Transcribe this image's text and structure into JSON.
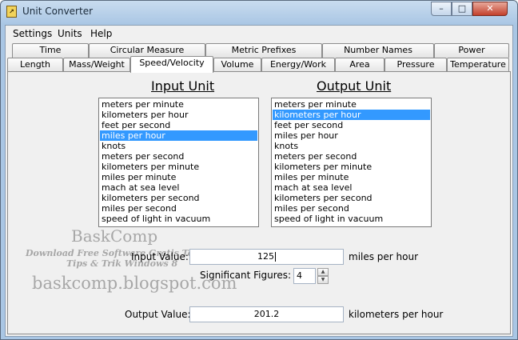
{
  "window": {
    "title": "Unit Converter",
    "icon": "converter-app-icon"
  },
  "titlebar_buttons": {
    "minimize": "–",
    "maximize": "□",
    "close": "✕"
  },
  "menu": [
    "Settings",
    "Units",
    "Help"
  ],
  "tabs_top": [
    "Time",
    "Circular Measure",
    "Metric Prefixes",
    "Number Names",
    "Power"
  ],
  "tabs_bottom": [
    "Length",
    "Mass/Weight",
    "Speed/Velocity",
    "Volume",
    "Energy/Work",
    "Area",
    "Pressure",
    "Temperature"
  ],
  "active_tab": "Speed/Velocity",
  "input_unit": {
    "heading": "Input Unit",
    "options": [
      "meters per minute",
      "kilometers per hour",
      "feet per second",
      "miles per hour",
      "knots",
      "meters per second",
      "kilometers per minute",
      "miles per minute",
      "mach at sea level",
      "kilometers per second",
      "miles per second",
      "speed of light in vacuum"
    ],
    "selected": "miles per hour"
  },
  "output_unit": {
    "heading": "Output Unit",
    "options": [
      "meters per minute",
      "kilometers per hour",
      "feet per second",
      "miles per hour",
      "knots",
      "meters per second",
      "kilometers per minute",
      "miles per minute",
      "mach at sea level",
      "kilometers per second",
      "miles per second",
      "speed of light in vacuum"
    ],
    "selected": "kilometers per hour"
  },
  "input_value": {
    "label": "Input Value:",
    "value": "125",
    "unit": "miles per hour"
  },
  "significant_figures": {
    "label": "Significant Figures:",
    "value": "4"
  },
  "output_value": {
    "label": "Output Value:",
    "value": "201.2",
    "unit": "kilometers per hour"
  },
  "watermark": {
    "brand": "BaskComp",
    "line1": "Download Free Software Gratis Terbaru",
    "line2": "Tips & Trik Windows 8",
    "url": "baskcomp.blogspot.com"
  },
  "colors": {
    "selection": "#3399ff",
    "window_frame": "#a9c6e4",
    "close_button": "#c3402c"
  }
}
